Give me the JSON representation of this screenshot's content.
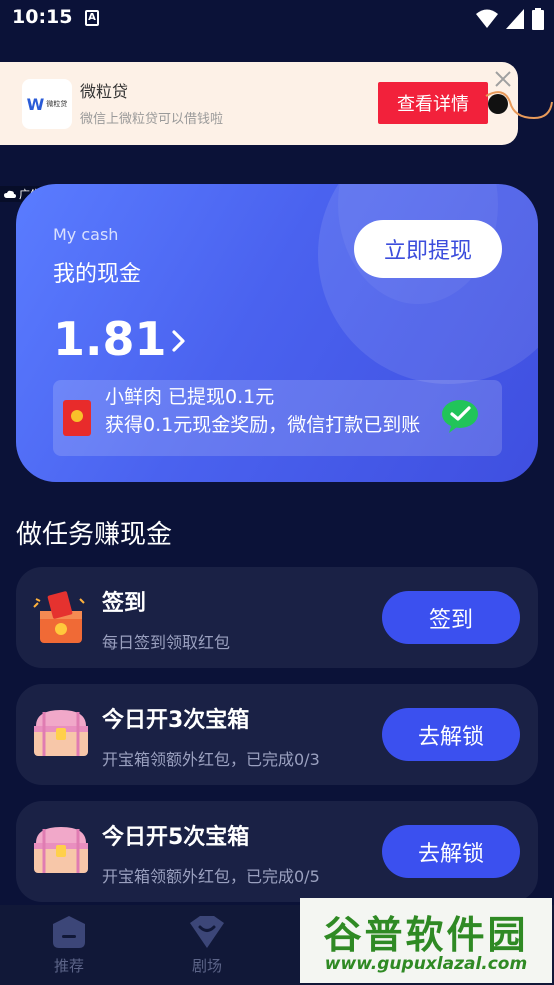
{
  "status_bar": {
    "time": "10:15",
    "a_badge": "A"
  },
  "ad": {
    "title": "微粒贷",
    "description": "微信上微粒贷可以借钱啦",
    "cta": "查看详情",
    "tag": "广告",
    "logo_letter": "W",
    "logo_text": "微粒贷"
  },
  "cash": {
    "label_en": "My cash",
    "label_cn": "我的现金",
    "withdraw_label": "立即提现",
    "amount": "1.81",
    "notice_line1": "小鲜肉 已提现0.1元",
    "notice_line2": "获得0.1元现金奖励，微信打款已到账"
  },
  "tasks": {
    "section_title": "做任务赚现金",
    "items": [
      {
        "title": "签到",
        "desc": "每日签到领取红包",
        "button": "签到",
        "icon": "gift-box-icon"
      },
      {
        "title": "今日开3次宝箱",
        "desc": "开宝箱领额外红包，已完成0/3",
        "button": "去解锁",
        "icon": "treasure-chest-icon"
      },
      {
        "title": "今日开5次宝箱",
        "desc": "开宝箱领额外红包，已完成0/5",
        "button": "去解锁",
        "icon": "treasure-chest-icon"
      }
    ]
  },
  "nav": {
    "items": [
      {
        "label": "推荐",
        "icon": "recommend-icon"
      },
      {
        "label": "剧场",
        "icon": "theater-icon"
      }
    ]
  },
  "watermark": {
    "line1": "谷普软件园",
    "line2": "www.gupuxlazal.com"
  },
  "colors": {
    "background": "#0b1238",
    "card": "#1a2145",
    "accent": "#3b50ef",
    "ad_cta": "#f2213b"
  }
}
